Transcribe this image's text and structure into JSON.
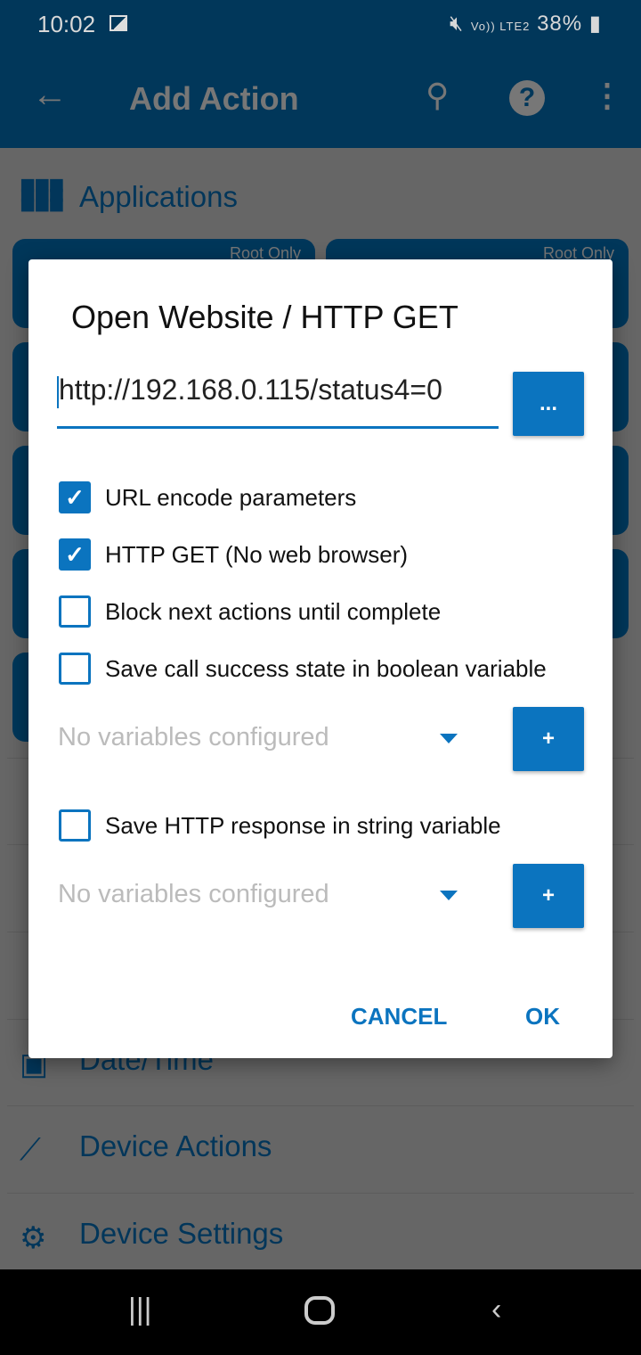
{
  "status_bar": {
    "time": "10:02",
    "battery": "38%",
    "network": "Vo)) LTE2"
  },
  "app_bar": {
    "title": "Add Action"
  },
  "background": {
    "section": "Applications",
    "card_badge": "Root Only",
    "items": [
      {
        "label": "Date/Time"
      },
      {
        "label": "Device Actions"
      },
      {
        "label": "Device Settings"
      }
    ]
  },
  "dialog": {
    "title": "Open Website / HTTP GET",
    "url_value": "http://192.168.0.115/status4=0",
    "browse_label": "...",
    "checkboxes": [
      {
        "label": "URL encode parameters",
        "checked": true
      },
      {
        "label": "HTTP GET (No web browser)",
        "checked": true
      },
      {
        "label": "Block next actions until complete",
        "checked": false
      },
      {
        "label": "Save call success state in boolean variable",
        "checked": false
      },
      {
        "label": "Save HTTP response in string variable",
        "checked": false
      }
    ],
    "boolean_variable_select": "No variables configured",
    "string_variable_select": "No variables configured",
    "add_label": "+",
    "cancel": "CANCEL",
    "ok": "OK"
  },
  "colors": {
    "accent": "#0b74bf",
    "app_bar": "#01375a"
  }
}
